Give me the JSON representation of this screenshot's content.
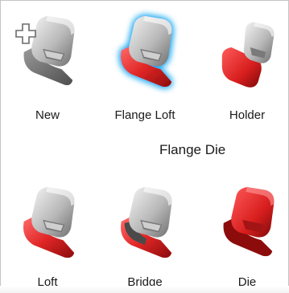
{
  "group_title": "Flange Die",
  "tools": [
    {
      "label": "New",
      "icon": "new-flange-die-icon",
      "variant": "new"
    },
    {
      "label": "Flange Loft",
      "icon": "flange-loft-icon",
      "variant": "loft-selected"
    },
    {
      "label": "Holder",
      "icon": "holder-icon",
      "variant": "holder"
    },
    {
      "label": "Loft",
      "icon": "loft-icon",
      "variant": "loft"
    },
    {
      "label": "Bridge",
      "icon": "bridge-icon",
      "variant": "bridge"
    },
    {
      "label": "Die",
      "icon": "die-icon",
      "variant": "die"
    }
  ],
  "colors": {
    "red": "#e02626",
    "red_dark": "#9e1010",
    "gray_light": "#eeeeee",
    "gray_mid": "#a9a9a9",
    "gray_dark": "#6a6a6a",
    "selection_glow": "#18a6f0"
  }
}
